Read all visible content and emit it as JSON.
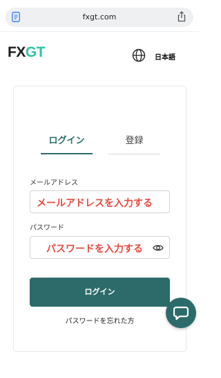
{
  "browser": {
    "url": "fxgt.com",
    "page_icon": "document-icon",
    "share_icon": "share-icon"
  },
  "header": {
    "logo_fx": "FX",
    "logo_gt": "GT",
    "language_icon": "globe-icon",
    "language_label": "日本語"
  },
  "tabs": [
    {
      "label": "ログイン",
      "active": true
    },
    {
      "label": "登録",
      "active": false
    }
  ],
  "form": {
    "email_label": "メールアドレス",
    "email_value": "メールアドレスを入力する",
    "password_label": "パスワード",
    "password_value": "パスワードを入力する",
    "password_toggle_icon": "eye-icon",
    "submit_label": "ログイン",
    "forgot_link": "パスワードを忘れた方"
  },
  "chat": {
    "icon": "chat-bubble-icon"
  },
  "colors": {
    "brand_teal": "#2d6b6b",
    "logo_accent": "#2ec4a6",
    "annotation_red": "#e84a3f"
  }
}
